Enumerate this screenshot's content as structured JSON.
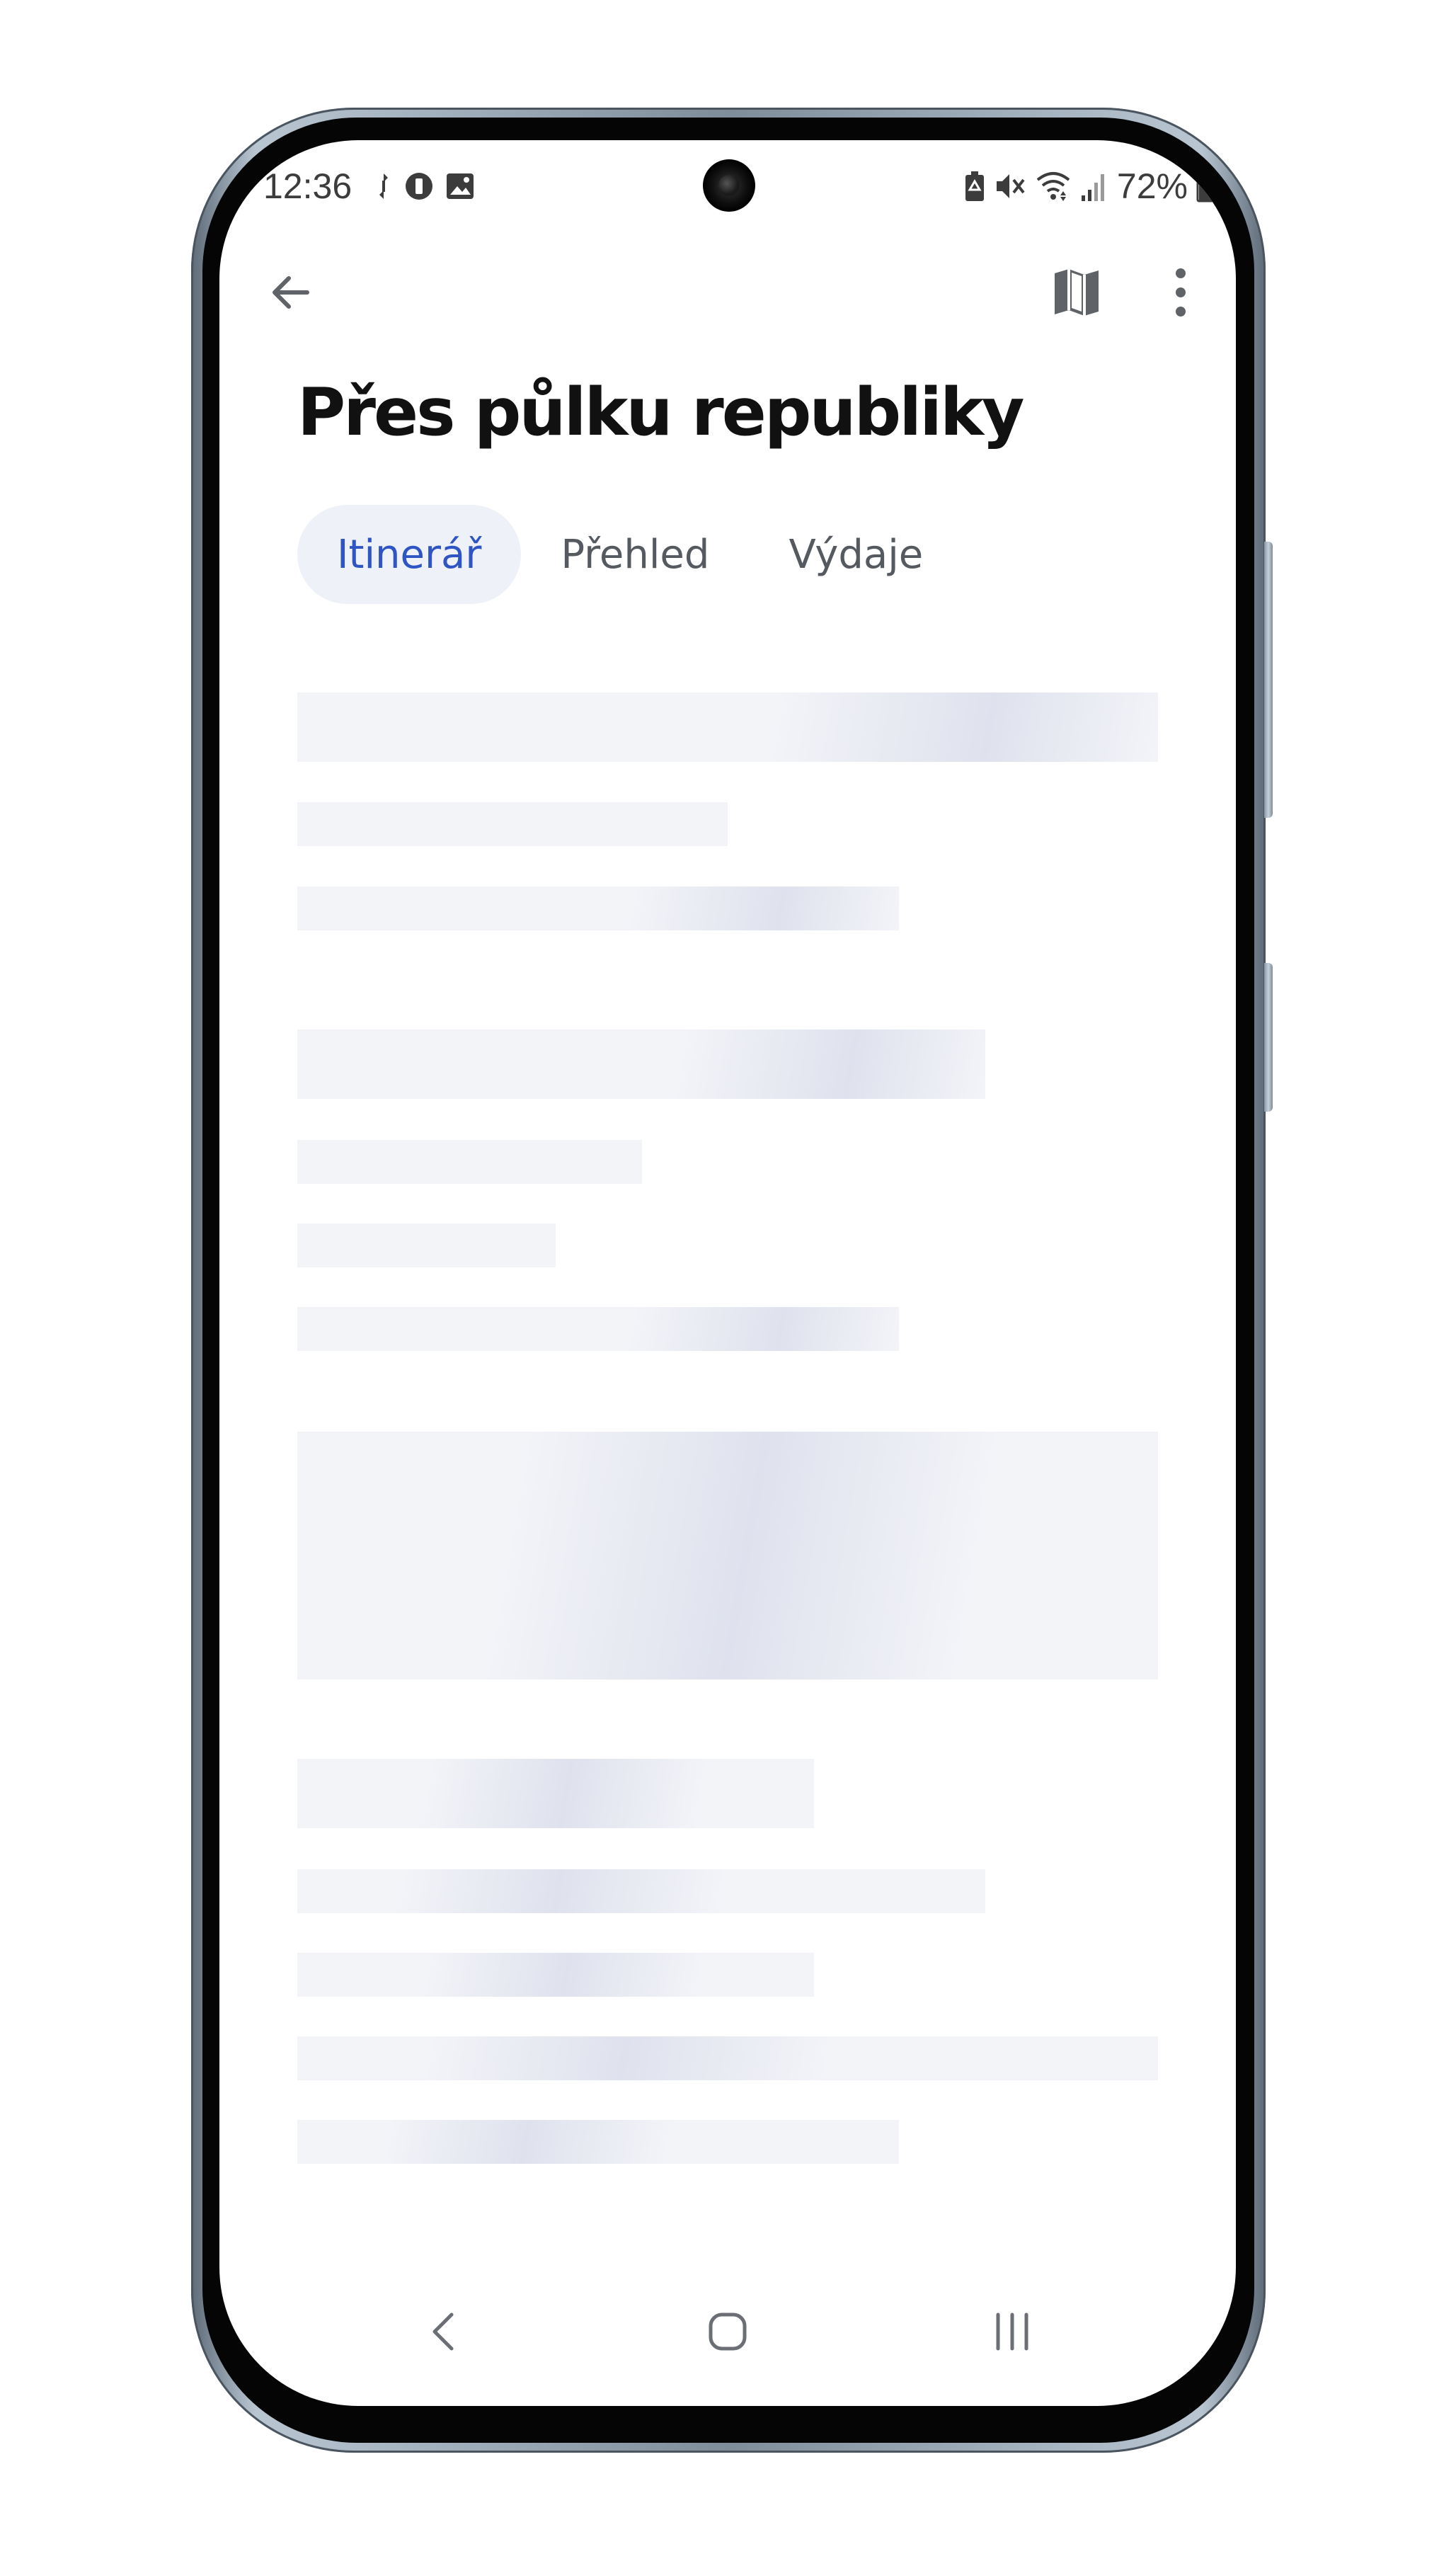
{
  "status_bar": {
    "time": "12:36",
    "battery_percent": "72%",
    "left_icons": [
      "sync-icon",
      "data-saver-icon",
      "image-icon"
    ],
    "right_icons": [
      "battery-saver-icon",
      "mute-icon",
      "wifi-icon",
      "signal-icon",
      "battery-icon"
    ]
  },
  "app_bar": {
    "icons": [
      "arrow-left-icon",
      "map-icon",
      "more-vert-icon"
    ]
  },
  "page": {
    "title": "Přes půlku republiky"
  },
  "tabs": [
    {
      "label": "Itinerář",
      "active": true
    },
    {
      "label": "Přehled",
      "active": false
    },
    {
      "label": "Výdaje",
      "active": false
    }
  ],
  "nav_bar": {
    "icons": [
      "nav-back-icon",
      "nav-home-icon",
      "nav-recents-icon"
    ]
  },
  "colors": {
    "accent": "#2f55c4",
    "tab_active_bg": "#eef2f8",
    "skeleton_base": "#f3f4f8",
    "skeleton_shine": "#dfe2ee",
    "title": "#111111"
  }
}
